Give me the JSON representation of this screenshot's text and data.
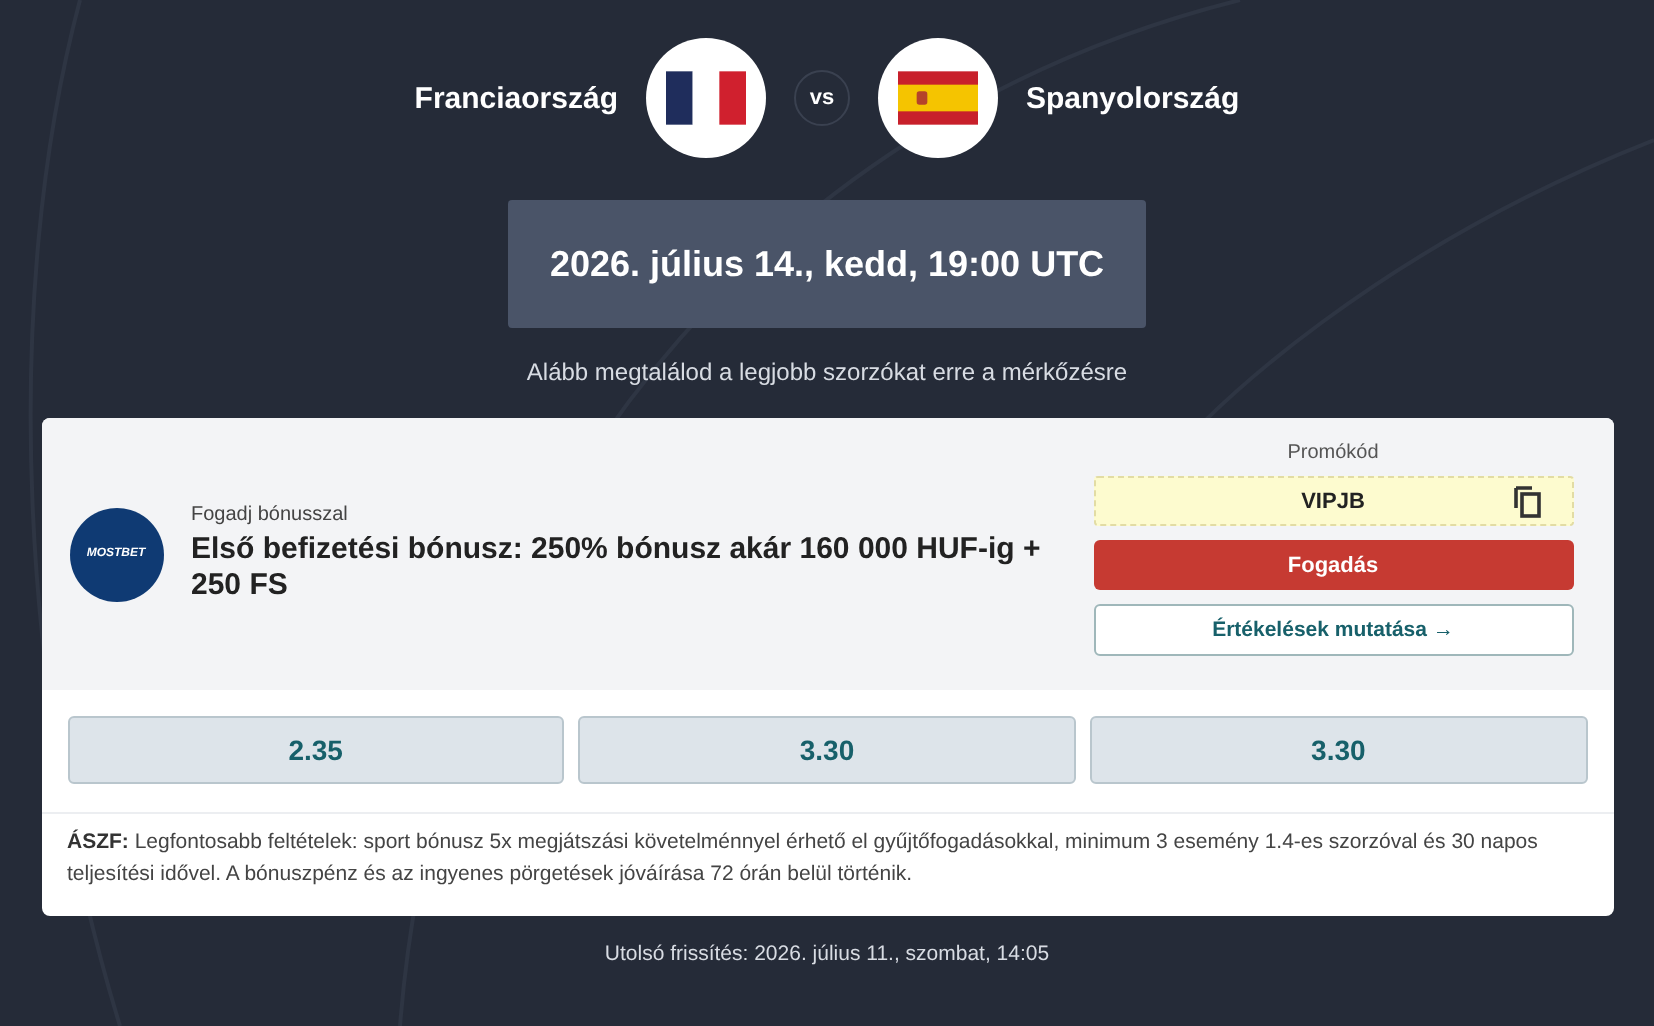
{
  "match": {
    "home": "Franciaország",
    "vs": "vs",
    "away": "Spanyolország",
    "date": "2026. július 14., kedd, 19:00 UTC",
    "subtitle": "Alább megtalálod a legjobb szorzókat erre a mérkőzésre"
  },
  "offer": {
    "logo_text": "MOSTBET",
    "eyebrow": "Fogadj bónusszal",
    "title": "Első befizetési bónusz: 250% bónusz akár 160 000 HUF-ig + 250 FS",
    "promo_label": "Promókód",
    "promo_code": "VIPJB",
    "bet_button": "Fogadás",
    "reviews_button": "Értékelések mutatása →",
    "odds": [
      "2.35",
      "3.30",
      "3.30"
    ],
    "terms_lead": "ÁSZF:",
    "terms": "Legfontosabb feltételek: sport bónusz 5x megjátszási követelménnyel érhető el gyűjtőfogadásokkal, minimum 3 esemény 1.4-es szorzóval és 30 napos teljesítési idővel. A bónuszpénz és az ingyenes pörgetések jóváírása 72 órán belül történik."
  },
  "footer": "Utolsó frissítés: 2026. július 11., szombat, 14:05"
}
